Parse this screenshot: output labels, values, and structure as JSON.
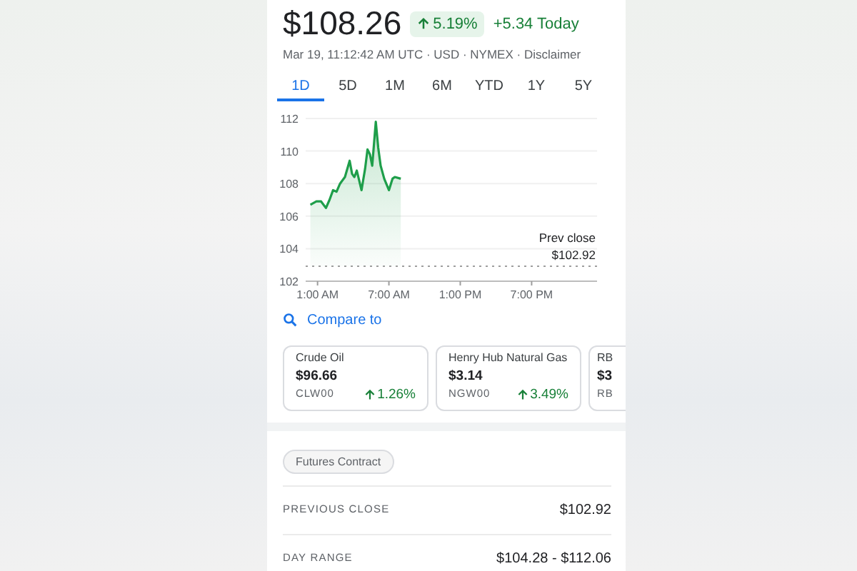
{
  "quote": {
    "price": "$108.26",
    "change_percent": "5.19%",
    "change_today": "+5.34 Today",
    "meta": "Mar 19, 11:12:42 AM UTC · USD · NYMEX · Disclaimer"
  },
  "ranges": [
    {
      "label": "1D",
      "selected": true
    },
    {
      "label": "5D",
      "selected": false
    },
    {
      "label": "1M",
      "selected": false
    },
    {
      "label": "6M",
      "selected": false
    },
    {
      "label": "YTD",
      "selected": false
    },
    {
      "label": "1Y",
      "selected": false
    },
    {
      "label": "5Y",
      "selected": false
    }
  ],
  "chart": {
    "chart_data": {
      "type": "area",
      "x": [
        0.4,
        0.9,
        1.3,
        1.7,
        2.0,
        2.3,
        2.6,
        2.9,
        3.3,
        3.7,
        3.9,
        4.1,
        4.3,
        4.7,
        5.0,
        5.2,
        5.4,
        5.6,
        5.9,
        6.1,
        6.3,
        6.6,
        7.0,
        7.3,
        7.5,
        8.0
      ],
      "series": [
        {
          "color": "#1e9e4a",
          "values": [
            106.7,
            106.9,
            106.9,
            106.5,
            107.0,
            107.6,
            107.5,
            108.0,
            108.4,
            109.4,
            108.6,
            108.4,
            108.8,
            107.6,
            108.9,
            110.1,
            109.8,
            109.1,
            111.8,
            110.2,
            109.1,
            108.3,
            107.6,
            108.3,
            108.4,
            108.3
          ]
        }
      ],
      "xlim": [
        0,
        24.5
      ],
      "ylim": [
        102,
        112
      ],
      "xticks": [
        {
          "value": 1,
          "label": "1:00 AM"
        },
        {
          "value": 7,
          "label": "7:00 AM"
        },
        {
          "value": 13,
          "label": "1:00 PM"
        },
        {
          "value": 19,
          "label": "7:00 PM"
        }
      ],
      "yticks": [
        102,
        104,
        106,
        108,
        110,
        112
      ],
      "grid": true,
      "ref_lines": [
        {
          "axis": "y",
          "value": 102.92,
          "label": "Prev close"
        }
      ],
      "annotations": [
        "$102.92"
      ]
    }
  },
  "compare": {
    "label": "Compare to",
    "cards": [
      {
        "name": "Crude Oil",
        "price": "$96.66",
        "symbol": "CLW00",
        "change": "1.26%"
      },
      {
        "name": "Henry Hub Natural Gas",
        "price": "$3.14",
        "symbol": "NGW00",
        "change": "3.49%"
      },
      {
        "name": "RB",
        "price": "$3",
        "symbol": "RB"
      }
    ]
  },
  "chip": "Futures Contract",
  "stats": [
    {
      "label": "PREVIOUS CLOSE",
      "value": "$102.92"
    },
    {
      "label": "DAY RANGE",
      "value": "$104.28 - $112.06"
    }
  ]
}
